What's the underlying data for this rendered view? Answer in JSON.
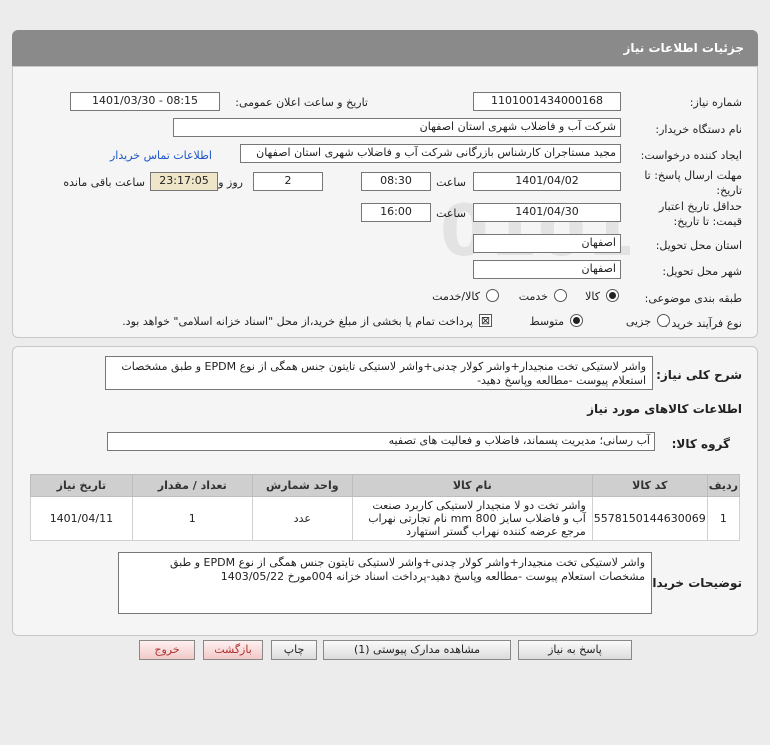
{
  "header": {
    "title": "جزئیات اطلاعات نیاز"
  },
  "labels": {
    "need_number": "شماره نیاز:",
    "announce_datetime": "تاریخ و ساعت اعلان عمومی:",
    "buyer_org": "نام دستگاه خریدار:",
    "requester": "ایجاد کننده درخواست:",
    "contact_link": "اطلاعات تماس خریدار",
    "reply_deadline_1": "مهلت ارسال پاسخ: تا",
    "reply_deadline_2": "تاریخ:",
    "time": "ساعت",
    "day_and": "روز و",
    "time_remaining": "ساعت باقی مانده",
    "validity_1": "حداقل تاریخ اعتبار",
    "validity_2": "قیمت: تا تاریخ:",
    "delivery_province": "استان محل تحویل:",
    "delivery_city": "شهر محل تحویل:",
    "subject_category": "طبقه بندی موضوعی:",
    "process_type": "نوع فرآیند خرید :",
    "general_desc": "شرح کلی نیاز:",
    "goods_info": "اطلاعات کالاهای مورد نیاز",
    "goods_group": "گروه کالا:",
    "buyer_notes": "توضیحات خریدار:"
  },
  "values": {
    "need_number": "1101001434000168",
    "announce_datetime": "1401/03/30 - 08:15",
    "buyer_org": "شرکت آب و فاضلاب شهری استان اصفهان",
    "requester": "مجید مستاجران کارشناس بازرگانی شرکت آب و فاضلاب شهری استان اصفهان",
    "reply_date": "1401/04/02",
    "reply_time": "08:30",
    "days": "2",
    "remaining": "23:17:05",
    "validity_date": "1401/04/30",
    "validity_time": "16:00",
    "province": "اصفهان",
    "city": "اصفهان",
    "general_desc": "واشر لاستیکی تخت منجیدار+واشر کولار چدنی+واشر لاستیکی تایتون جنس همگی از نوع  EPDM و طبق مشخصات استعلام پیوست -مطالعه وپاسخ دهید-",
    "goods_group": "آب رسانی؛ مدیریت پسماند، فاضلاب و فعالیت های تصفیه",
    "buyer_notes": "واشر لاستیکی تخت منجیدار+واشر کولار چدنی+واشر لاستیکی تایتون جنس همگی از نوع  EPDM و طبق مشخصات استعلام پیوست -مطالعه وپاسخ دهید-پرداخت اسناد خزانه 004مورخ 1403/05/22"
  },
  "category_options": [
    {
      "label": "کالا",
      "selected": true
    },
    {
      "label": "خدمت",
      "selected": false
    },
    {
      "label": "کالا/خدمت",
      "selected": false
    }
  ],
  "process_options": [
    {
      "label": "جزیی",
      "selected": false
    },
    {
      "label": "متوسط",
      "selected": true
    }
  ],
  "payment_note": "پرداخت تمام یا بخشی از مبلغ خرید،از محل \"اسناد خزانه اسلامی\" خواهد بود.",
  "table": {
    "headers": [
      "ردیف",
      "کد کالا",
      "نام کالا",
      "واحد شمارش",
      "تعداد / مقدار",
      "تاریخ نیاز"
    ],
    "rows": [
      [
        "1",
        "5578150144630069",
        "واشر تخت دو لا منجیدار لاستیکی کاربرد صنعت آب و فاضلاب سایز 800 mm نام تجارتی نهراب مرجع عرضه کننده نهراب گستر استهارد",
        "عدد",
        "1",
        "1401/04/11"
      ]
    ]
  },
  "buttons": {
    "reply": "پاسخ به نیاز",
    "attachments": "مشاهده مدارک پیوستی (1)",
    "print": "چاپ",
    "back": "بازگشت",
    "exit": "خروج"
  },
  "watermark": {
    "brand": "ParsNamadData"
  }
}
